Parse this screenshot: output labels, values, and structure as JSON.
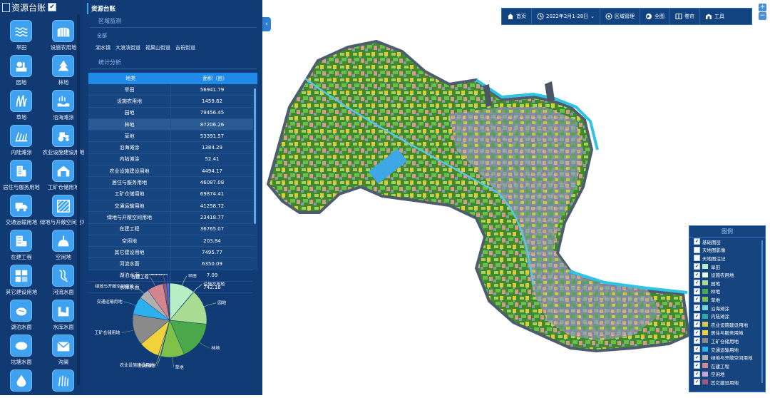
{
  "icon_panel": {
    "title": "资源台账",
    "checked_mark": "✔",
    "categories": [
      {
        "label": "旱田",
        "icon": "waves-icon"
      },
      {
        "label": "设施农用地",
        "icon": "greenhouse-icon"
      },
      {
        "label": "园地",
        "icon": "garden-icon"
      },
      {
        "label": "林地",
        "icon": "forest-icon"
      },
      {
        "label": "草地",
        "icon": "grass-icon"
      },
      {
        "label": "沿海滩涂",
        "icon": "coast-icon"
      },
      {
        "label": "内陆滩涂",
        "icon": "inland-flat-icon"
      },
      {
        "label": "农业设施建设用地",
        "icon": "tractor-icon"
      },
      {
        "label": "居住与服务用地",
        "icon": "building-icon"
      },
      {
        "label": "工矿仓储用地",
        "icon": "warehouse-icon"
      },
      {
        "label": "交通运输用地",
        "icon": "truck-icon"
      },
      {
        "label": "绿地与开敞空间用地",
        "icon": "hatch-icon"
      },
      {
        "label": "在建工程",
        "icon": "construction-icon"
      },
      {
        "label": "空闲地",
        "icon": "vacant-icon"
      },
      {
        "label": "其它建设用地",
        "icon": "blocks-icon"
      },
      {
        "label": "河流水面",
        "icon": "river-icon"
      },
      {
        "label": "湖泊水面",
        "icon": "lake-icon"
      },
      {
        "label": "水库水面",
        "icon": "reservoir-icon"
      },
      {
        "label": "坑塘水面",
        "icon": "pond-icon"
      },
      {
        "label": "沟渠",
        "icon": "ditch-icon"
      },
      {
        "label": "",
        "icon": "water-drop-icon"
      },
      {
        "label": "",
        "icon": "marsh-icon"
      }
    ]
  },
  "data_panel": {
    "title": "资源台账",
    "region_section": "区域监测",
    "scope_all": "全部",
    "streets": [
      "湖水镇",
      "大浪滨街道",
      "福果山街道",
      "吉祝街道"
    ],
    "stats_section": "统计分析",
    "table": {
      "headers": [
        "地类",
        "面积（亩）"
      ],
      "rows": [
        [
          "旱田",
          "56941.79"
        ],
        [
          "设施农用地",
          "1459.82"
        ],
        [
          "园地",
          "79456.45"
        ],
        [
          "林地",
          "87206.26"
        ],
        [
          "草地",
          "53391.57"
        ],
        [
          "沿海滩涂",
          "1384.29"
        ],
        [
          "内陆滩涂",
          "52.41"
        ],
        [
          "农业设施建设用地",
          "4494.17"
        ],
        [
          "居住与服务用地",
          "46087.08"
        ],
        [
          "工矿仓储用地",
          "69874.41"
        ],
        [
          "交通运输用地",
          "41258.72"
        ],
        [
          "绿地与开敞空间用地",
          "23418.77"
        ],
        [
          "在建工程",
          "36765.07"
        ],
        [
          "空闲地",
          "203.84"
        ],
        [
          "其它建设用地",
          "7495.77"
        ],
        [
          "河流水面",
          "6350.09"
        ],
        [
          "湖泊水面",
          "7.09"
        ],
        [
          "水库水面",
          "742.16"
        ]
      ]
    }
  },
  "chart_data": {
    "type": "pie",
    "slices": [
      {
        "label": "旱田",
        "value": 56941.79,
        "color": "#b6f0c4"
      },
      {
        "label": "设施农用地",
        "value": 1459.82,
        "color": "#e8ffe8"
      },
      {
        "label": "园地",
        "value": 79456.45,
        "color": "#a8dc92"
      },
      {
        "label": "林地",
        "value": 87206.26,
        "color": "#4aa84a"
      },
      {
        "label": "草地",
        "value": 53391.57,
        "color": "#7ec24a"
      },
      {
        "label": "沿海滩涂",
        "value": 1384.29,
        "color": "#6ed6d2"
      },
      {
        "label": "内陆滩涂",
        "value": 52.41,
        "color": "#2fa7a2"
      },
      {
        "label": "农业设施建设用地",
        "value": 4494.17,
        "color": "#d8c84a"
      },
      {
        "label": "居住与服务用地",
        "value": 46087.08,
        "color": "#f2d23a"
      },
      {
        "label": "工矿仓储用地",
        "value": 69874.41,
        "color": "#8a8a8a"
      },
      {
        "label": "交通运输用地",
        "value": 41258.72,
        "color": "#2fb0ee"
      },
      {
        "label": "绿地与开敞空间用地",
        "value": 23418.77,
        "color": "#b0b0b0"
      },
      {
        "label": "在建工程",
        "value": 36765.07,
        "color": "#d4868c"
      },
      {
        "label": "空闲地",
        "value": 203.84,
        "color": "#c3a3d8"
      },
      {
        "label": "其它建设用地",
        "value": 7495.77,
        "color": "#a0587a"
      },
      {
        "label": "河流水面",
        "value": 6350.09,
        "color": "#4a6fd0"
      },
      {
        "label": "湖泊水面",
        "value": 7.09,
        "color": "#7fb6e6"
      },
      {
        "label": "水库水面",
        "value": 742.16,
        "color": "#2a4aa0"
      }
    ],
    "visible_labels": [
      "旱田",
      "设施农用地",
      "园地",
      "林地",
      "草地",
      "沿海滩涂",
      "农业设施建设用地",
      "工矿仓储用地",
      "交通运输用地",
      "绿地与开敞空间用地",
      "在建工程",
      "其它建设用地",
      "河流水面",
      "水库水面"
    ]
  },
  "toolbar": {
    "items": [
      {
        "label": "首页",
        "icon": "home-icon"
      },
      {
        "label": "2022年2月1-28日",
        "icon": "clock-icon"
      },
      {
        "label": "区域管理",
        "icon": "location-icon"
      },
      {
        "label": "全图",
        "icon": "globe-icon"
      },
      {
        "label": "卷帘",
        "icon": "columns-icon"
      },
      {
        "label": "工具",
        "icon": "toolbox-icon"
      }
    ],
    "dropdown_mark": "⌄"
  },
  "zoom": {
    "in": "+",
    "out": "−"
  },
  "legend": {
    "title": "图例",
    "items": [
      {
        "label": "基础图层",
        "checked": true,
        "color": ""
      },
      {
        "label": "天地图影像",
        "checked": false,
        "color": ""
      },
      {
        "label": "天地图注记",
        "checked": false,
        "color": ""
      },
      {
        "label": "旱田",
        "checked": true,
        "color": "#b6f0c4"
      },
      {
        "label": "设施农用地",
        "checked": true,
        "color": "#e8ffe8"
      },
      {
        "label": "园地",
        "checked": true,
        "color": "#a8dc92"
      },
      {
        "label": "林地",
        "checked": true,
        "color": "#4aa84a"
      },
      {
        "label": "草地",
        "checked": true,
        "color": "#7ec24a"
      },
      {
        "label": "沿海滩涂",
        "checked": true,
        "color": "#6ed6d2"
      },
      {
        "label": "内陆滩涂",
        "checked": true,
        "color": "#2fa7a2"
      },
      {
        "label": "农业设施建设用地",
        "checked": true,
        "color": "#d8c84a"
      },
      {
        "label": "居住与服务用地",
        "checked": true,
        "color": "#f2d23a"
      },
      {
        "label": "工矿仓储用地",
        "checked": true,
        "color": "#8a8a8a"
      },
      {
        "label": "交通运输用地",
        "checked": true,
        "color": "#2fb0ee"
      },
      {
        "label": "绿地与开敞空间用地",
        "checked": true,
        "color": "#b0b0b0"
      },
      {
        "label": "在建工程",
        "checked": true,
        "color": "#d4868c"
      },
      {
        "label": "空闲地",
        "checked": true,
        "color": "#c3a3d8"
      },
      {
        "label": "其它建设用地",
        "checked": true,
        "color": "#a0587a"
      }
    ]
  },
  "collapse_arrow": "‹"
}
